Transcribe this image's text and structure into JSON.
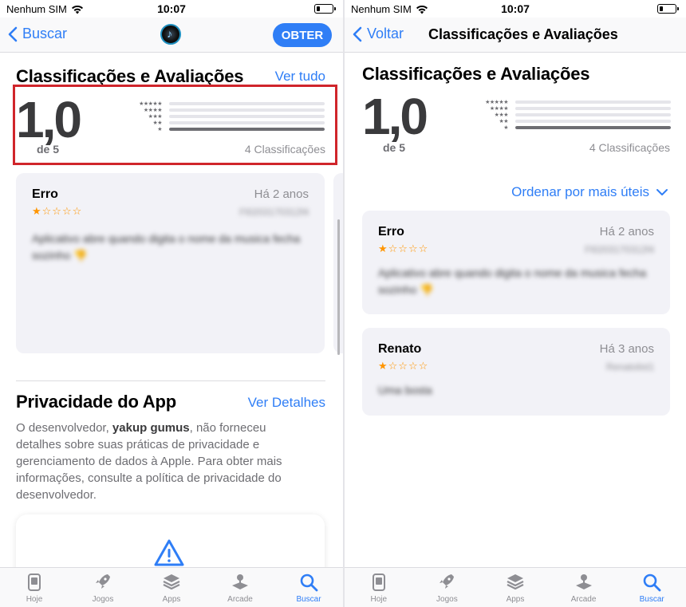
{
  "status": {
    "carrier": "Nenhum SIM",
    "time": "10:07"
  },
  "left": {
    "back_label": "Buscar",
    "get_label": "OBTER",
    "ratings_title": "Classificações e Avaliações",
    "see_all": "Ver tudo",
    "rating_value": "1,0",
    "rating_of": "de 5",
    "rating_count": "4 Classificações",
    "review": {
      "title": "Erro",
      "date": "Há 2 anos",
      "author": "Fl0203170312f4",
      "rating": 1,
      "body": "Aplicativo abre quando digita o nome da musica fecha sozinho 👎"
    },
    "privacy_title": "Privacidade do App",
    "privacy_link": "Ver Detalhes",
    "privacy_pre": "O desenvolvedor, ",
    "privacy_dev": "yakup gumus",
    "privacy_post": ", não forneceu detalhes sobre suas práticas de privacidade e gerenciamento de dados à Apple. Para obter mais informações, consulte a política de privacidade do desenvolvedor."
  },
  "right": {
    "back_label": "Voltar",
    "nav_title": "Classificações e Avaliações",
    "ratings_title": "Classificações e Avaliações",
    "rating_value": "1,0",
    "rating_of": "de 5",
    "rating_count": "4 Classificações",
    "sort_label": "Ordenar por mais úteis",
    "reviews": [
      {
        "title": "Erro",
        "date": "Há 2 anos",
        "author": "Fl0203170312f4",
        "rating": 1,
        "body": "Aplicativo abre quando digita o nome da musica fecha sozinho 👎"
      },
      {
        "title": "Renato",
        "date": "Há 3 anos",
        "author": "Renatolist1",
        "rating": 1,
        "body": "Uma bosta"
      }
    ]
  },
  "histogram": [
    {
      "stars": 5,
      "fraction": 0.0
    },
    {
      "stars": 4,
      "fraction": 0.0
    },
    {
      "stars": 3,
      "fraction": 0.0
    },
    {
      "stars": 2,
      "fraction": 0.0
    },
    {
      "stars": 1,
      "fraction": 1.0
    }
  ],
  "tabs": [
    {
      "label": "Hoje",
      "icon": "today-icon",
      "active": false
    },
    {
      "label": "Jogos",
      "icon": "rocket-icon",
      "active": false
    },
    {
      "label": "Apps",
      "icon": "layers-icon",
      "active": false
    },
    {
      "label": "Arcade",
      "icon": "joystick-icon",
      "active": false
    },
    {
      "label": "Buscar",
      "icon": "search-icon",
      "active": true
    }
  ],
  "colors": {
    "accent": "#2f7ef6",
    "star": "#ff9500",
    "highlight": "#d0252b",
    "card": "#f2f2f7"
  }
}
